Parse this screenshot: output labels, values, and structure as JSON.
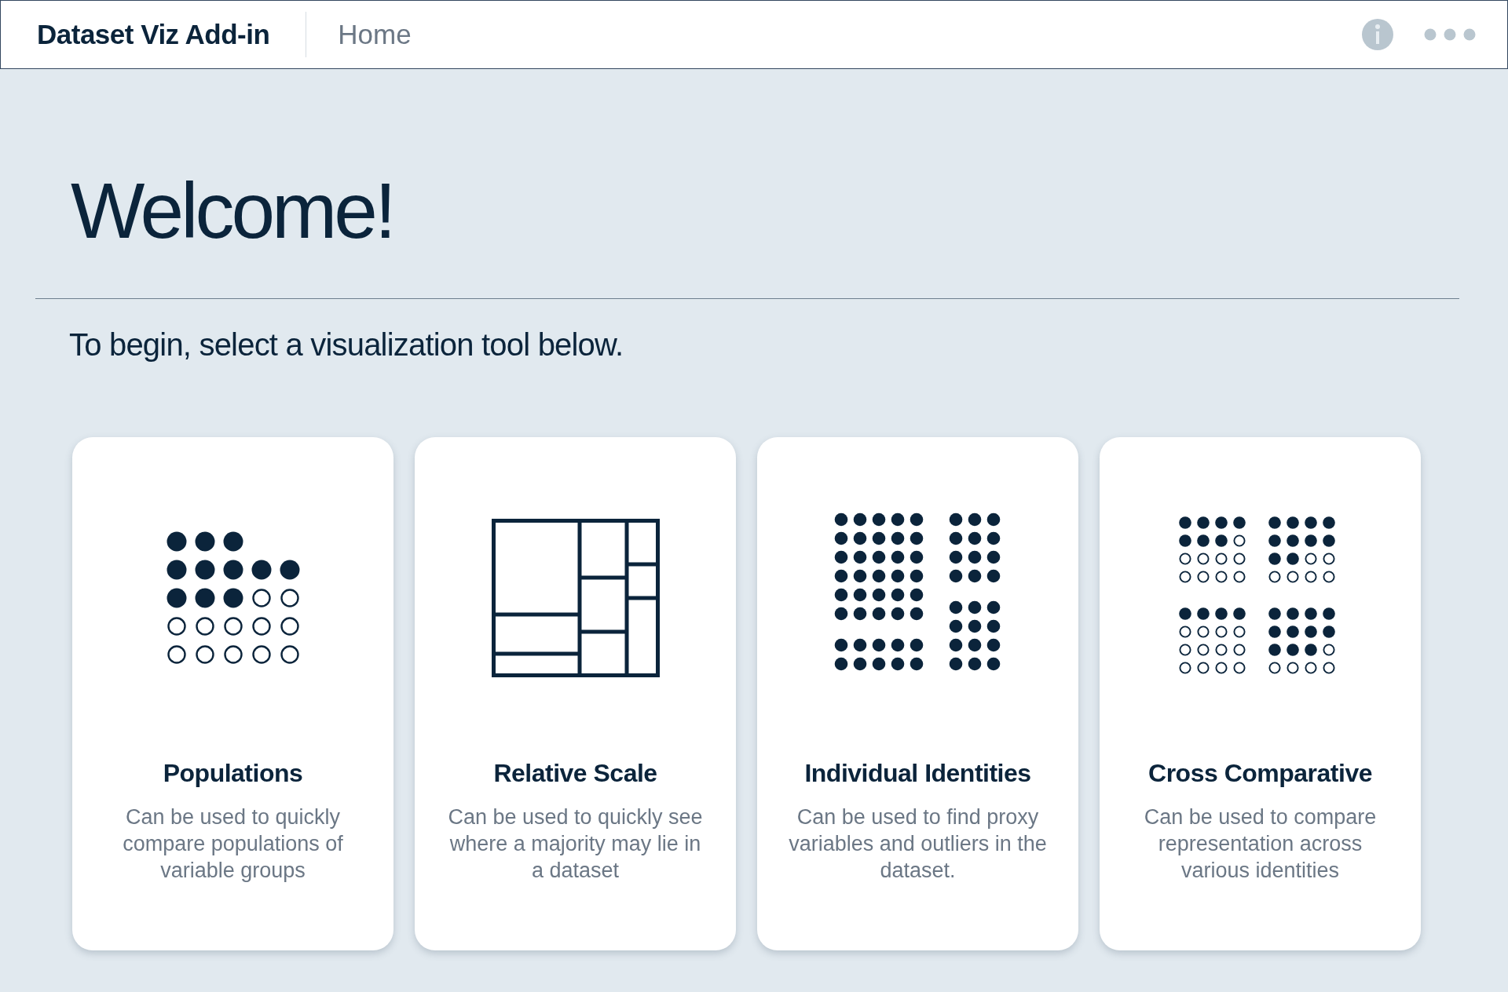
{
  "header": {
    "title": "Dataset Viz Add-in",
    "nav": "Home"
  },
  "welcome": {
    "heading": "Welcome!",
    "subtitle": "To begin, select a visualization tool below."
  },
  "cards": [
    {
      "kind": "populations",
      "title": "Populations",
      "description": "Can be used to quickly compare populations of variable groups"
    },
    {
      "kind": "treemap",
      "title": "Relative Scale",
      "description": "Can be used to quickly see where a majority may lie in a dataset"
    },
    {
      "kind": "identities",
      "title": "Individual Identities",
      "description": "Can be used to find proxy variables and outliers in the dataset."
    },
    {
      "kind": "comparative",
      "title": "Cross Comparative",
      "description": "Can be used to compare representation across various identities"
    }
  ]
}
